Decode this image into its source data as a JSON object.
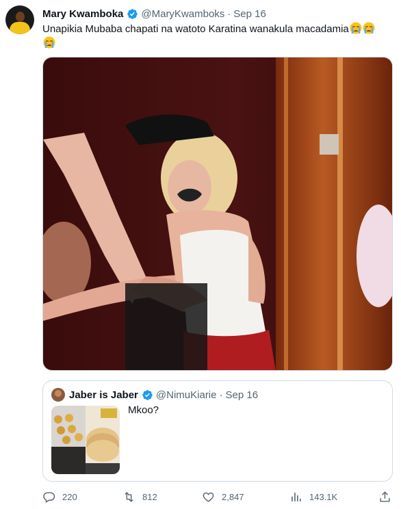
{
  "tweet": {
    "author_name": "Mary Kwamboka",
    "author_handle": "@MaryKwamboks",
    "separator": "·",
    "date": "Sep 16",
    "text": "Unapikia Mubaba chapati na watoto Karatina wanakula macadamia",
    "emojis": [
      "loudly-crying-face",
      "loudly-crying-face",
      "loudly-crying-face"
    ],
    "verified_color": "#1d9bf0"
  },
  "quote": {
    "author_name": "Jaber is Jaber",
    "author_handle": "@NimuKiarie",
    "separator": "·",
    "date": "Sep 16",
    "text": "Mkoo?"
  },
  "actions": {
    "replies": "220",
    "retweets": "812",
    "likes": "2,847",
    "views": "143.1K"
  },
  "colors": {
    "text": "#0f1419",
    "secondary": "#536471",
    "border": "#cfd9de",
    "accent": "#1d9bf0"
  }
}
